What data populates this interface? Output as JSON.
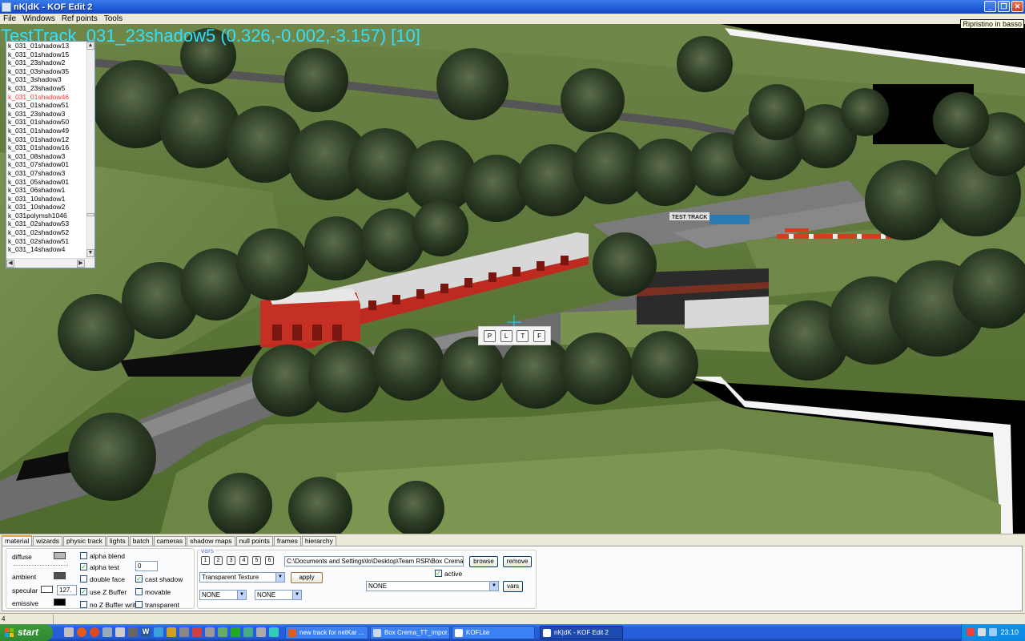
{
  "window": {
    "title": "nK|dK - KOF Edit 2"
  },
  "menu": [
    "File",
    "Windows",
    "Ref points",
    "Tools"
  ],
  "tooltip": "Ripristino in basso",
  "viewport": {
    "overlay_text": "TestTrack_031_23shadow5 (0.326,-0.002,-3.157) [10]",
    "sign_text": "TEST TRACK",
    "view_buttons": [
      "P",
      "L",
      "T",
      "F"
    ]
  },
  "object_list": {
    "selected_index": 6,
    "items": [
      "k_031_01shadow13",
      "k_031_01shadow15",
      "k_031_23shadow2",
      "k_031_03shadow35",
      "k_031_3shadow3",
      "k_031_23shadow5",
      "k_031_01shadow46",
      "k_031_01shadow51",
      "k_031_23shadow3",
      "k_031_01shadow50",
      "k_031_01shadow49",
      "k_031_01shadow12",
      "k_031_01shadow16",
      "k_031_08shadow3",
      "k_031_07shadow01",
      "k_031_07shadow3",
      "k_031_05shadow01",
      "k_031_06shadow1",
      "k_031_10shadow1",
      "k_031_10shadow2",
      "k_031polymsh1046",
      "k_031_02shadow53",
      "k_031_02shadow52",
      "k_031_02shadow51",
      "k_031_14shadow4"
    ]
  },
  "tabs": [
    "material",
    "wizards",
    "physic track",
    "lights",
    "batch",
    "cameras",
    "shadow maps",
    "null points",
    "frames",
    "hierarchy"
  ],
  "active_tab": "material",
  "material": {
    "diffuse_label": "diffuse",
    "ambient_label": "ambient",
    "specular_label": "specular",
    "specular_value": "127.",
    "emissive_label": "emissive",
    "colors": {
      "diffuse": "#b8b8b8",
      "ambient": "#505050",
      "specular": "#ffffff",
      "emissive": "#000000"
    },
    "checkboxes": [
      {
        "label": "alpha blend",
        "checked": false
      },
      {
        "label": "alpha test",
        "checked": true
      },
      {
        "label": "double face",
        "checked": false
      },
      {
        "label": "use Z Buffer",
        "checked": true
      },
      {
        "label": "no Z Buffer write",
        "checked": false
      },
      {
        "label": "cast shadow",
        "checked": true
      },
      {
        "label": "movable",
        "checked": false
      },
      {
        "label": "transparent",
        "checked": false
      }
    ],
    "alpha_test_value": "0",
    "vars_group_label": "vars",
    "var_buttons": [
      "1",
      "2",
      "3",
      "4",
      "5",
      "6"
    ],
    "shader_select": "Transparent Texture",
    "apply_label": "apply",
    "texture_select_1": "NONE",
    "texture_select_2": "NONE",
    "texture_path": "C:\\Documents and Settings\\lo\\Desktop\\Team RSR\\Box Crema\\TT/",
    "browse_label": "browse",
    "remove_label": "remove",
    "active_label": "active",
    "active_checked": true,
    "vars_select": "NONE",
    "vars_button_label": "vars"
  },
  "status": {
    "left": "4"
  },
  "taskbar": {
    "start_label": "start",
    "tasks": [
      "new track for netKar ...",
      "Box Crema_TT_impor...",
      "KOFLite",
      "nK|dK - KOF Edit 2"
    ],
    "active_task": 3,
    "clock": "23.10"
  }
}
